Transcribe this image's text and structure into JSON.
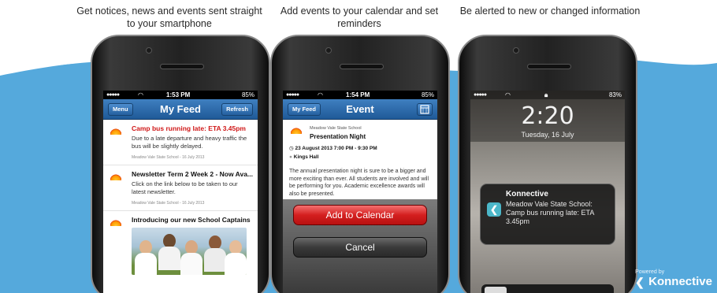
{
  "captions": [
    "Get notices, news and events sent straight to your smartphone",
    "Add events to your calendar and set reminders",
    "Be alerted to new or changed information"
  ],
  "colors": {
    "wave": "#55a9dc",
    "navbar": "#2a66a6",
    "alert_red": "#d01818",
    "add_button": "#e03030"
  },
  "phone1": {
    "status": {
      "wifi": "◠",
      "time": "1:53 PM",
      "battery": "85%"
    },
    "nav": {
      "left_button": "Menu",
      "title": "My Feed",
      "right_button": "Refresh"
    },
    "items": [
      {
        "title": "Camp bus running late: ETA 3.45pm",
        "body": "Due to a late departure and heavy traffic the bus will be slightly delayed.",
        "meta": "Meadow Vale State School - 16 July 2013"
      },
      {
        "title": "Newsletter Term 2 Week 2 - Now Ava...",
        "body": "Click on the link below to be taken to our latest newsletter.",
        "meta": "Meadow Vale State School - 16 July 2013"
      },
      {
        "title": "Introducing our new School Captains"
      }
    ]
  },
  "phone2": {
    "status": {
      "time": "1:54 PM",
      "battery": "85%"
    },
    "nav": {
      "left_button": "My Feed",
      "title": "Event",
      "right_icon": "calendar-icon"
    },
    "event": {
      "org": "Meadow Vale State School",
      "name": "Presentation Night",
      "when": "23 August 2013 7:00 PM - 9:30 PM",
      "where": "Kings Hall",
      "description": "The annual presentation night is sure to be a bigger and more exciting than ever.  All students are involved and will be performing for you.  Academic excellence awards will also be presented."
    },
    "sheet": {
      "primary": "Add to Calendar",
      "secondary": "Cancel"
    }
  },
  "phone3": {
    "status": {
      "battery": "83%"
    },
    "lock": {
      "time": "2:20",
      "date": "Tuesday, 16 July"
    },
    "notification": {
      "app": "Konnective",
      "body": "Meadow Vale State School: Camp bus running late: ETA 3.45pm"
    }
  },
  "brand": {
    "powered_by": "Powered by",
    "name": "Konnective"
  }
}
